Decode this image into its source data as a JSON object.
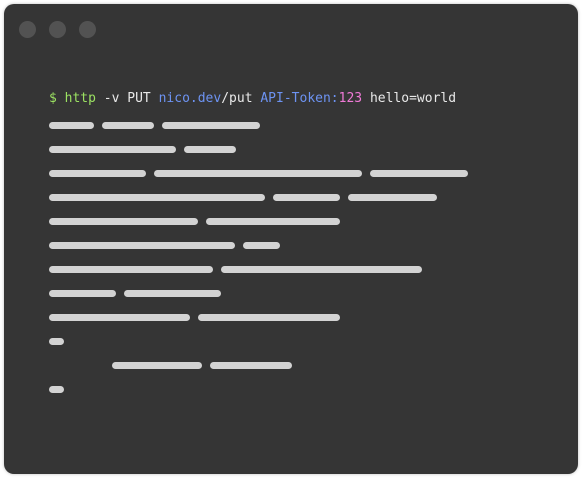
{
  "window": {
    "traffic_lights": [
      "close-dot",
      "minimize-dot",
      "zoom-dot"
    ],
    "bg_color": "#353535"
  },
  "command": {
    "prompt": "$",
    "program": "http",
    "flags": "-v PUT",
    "host": "nico",
    "domain": ".dev",
    "path": "/put",
    "header_name": "API-Token:",
    "header_value": "123",
    "body": "hello=world"
  },
  "colors": {
    "prompt": "#9ce262",
    "url": "#6d93f2",
    "header_value": "#f07ad7",
    "text": "#e9e9e9",
    "placeholder_bar": "#d3d3d3"
  }
}
